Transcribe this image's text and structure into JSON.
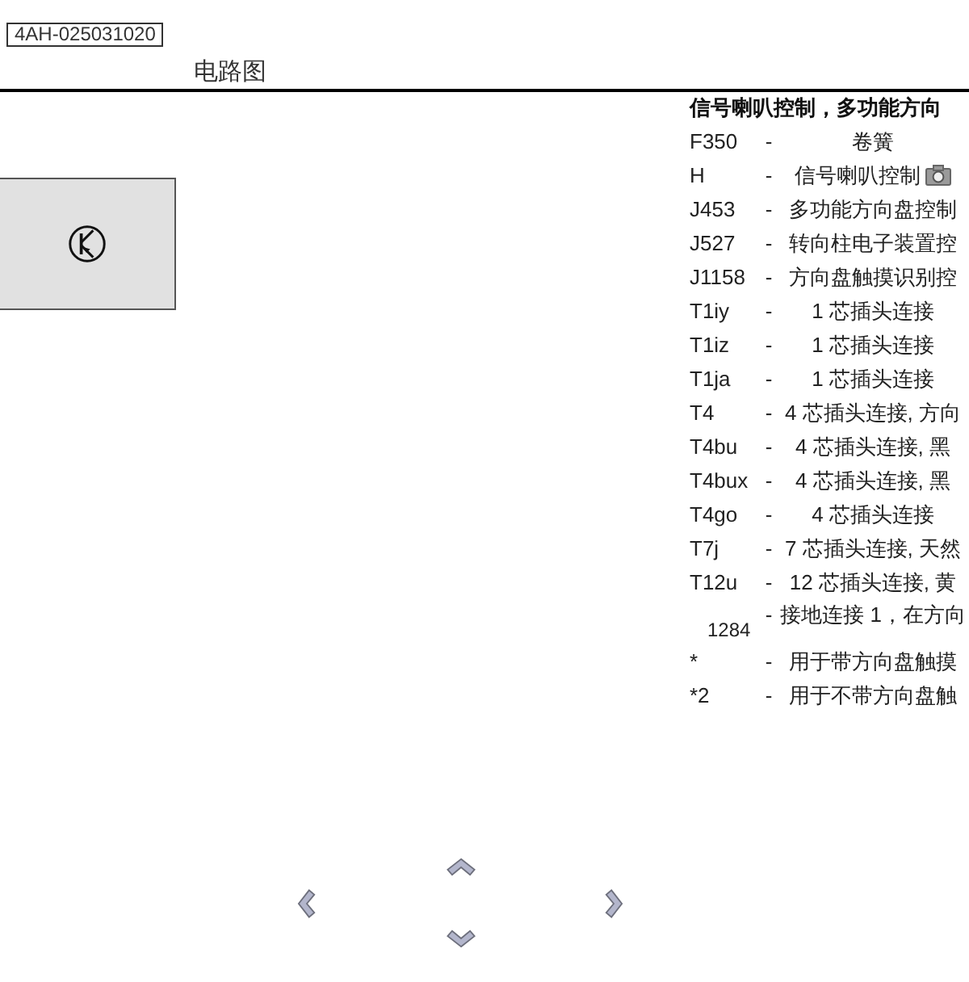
{
  "document_id": "4AH-025031020",
  "diagram": {
    "title": "电路图"
  },
  "legend": {
    "heading": "信号喇叭控制，多功能方向",
    "rows": [
      {
        "code": "F350",
        "separator": "-",
        "description": "卷簧",
        "kind": "part",
        "photo": false
      },
      {
        "code": "H",
        "separator": "-",
        "description": "信号喇叭控制",
        "kind": "part",
        "photo": true
      },
      {
        "code": "J453",
        "separator": "-",
        "description": "多功能方向盘控制",
        "kind": "part",
        "photo": false
      },
      {
        "code": "J527",
        "separator": "-",
        "description": "转向柱电子装置控",
        "kind": "part",
        "photo": false
      },
      {
        "code": "J1158",
        "separator": "-",
        "description": "方向盘触摸识别控",
        "kind": "part",
        "photo": false
      },
      {
        "code": "T1iy",
        "separator": "-",
        "description": "1 芯插头连接",
        "kind": "part",
        "photo": false
      },
      {
        "code": "T1iz",
        "separator": "-",
        "description": "1 芯插头连接",
        "kind": "part",
        "photo": false
      },
      {
        "code": "T1ja",
        "separator": "-",
        "description": "1 芯插头连接",
        "kind": "part",
        "photo": false
      },
      {
        "code": "T4",
        "separator": "-",
        "description": "4 芯插头连接, 方向",
        "kind": "part",
        "photo": false
      },
      {
        "code": "T4bu",
        "separator": "-",
        "description": "4 芯插头连接, 黑",
        "kind": "part",
        "photo": false
      },
      {
        "code": "T4bux",
        "separator": "-",
        "description": "4 芯插头连接, 黑",
        "kind": "part",
        "photo": false
      },
      {
        "code": "T4go",
        "separator": "-",
        "description": "4 芯插头连接",
        "kind": "part",
        "photo": false
      },
      {
        "code": "T7j",
        "separator": "-",
        "description": "7 芯插头连接, 天然",
        "kind": "part",
        "photo": false
      },
      {
        "code": "T12u",
        "separator": "-",
        "description": "12 芯插头连接, 黄",
        "kind": "part",
        "photo": false
      },
      {
        "code": "1284",
        "separator": "-",
        "description": "接地连接 1，在方向",
        "kind": "ground",
        "photo": false
      },
      {
        "code": "*",
        "separator": "-",
        "description": "用于带方向盘触摸",
        "kind": "part",
        "photo": false
      },
      {
        "code": "*2",
        "separator": "-",
        "description": "用于不带方向盘触",
        "kind": "part",
        "photo": false
      }
    ]
  }
}
